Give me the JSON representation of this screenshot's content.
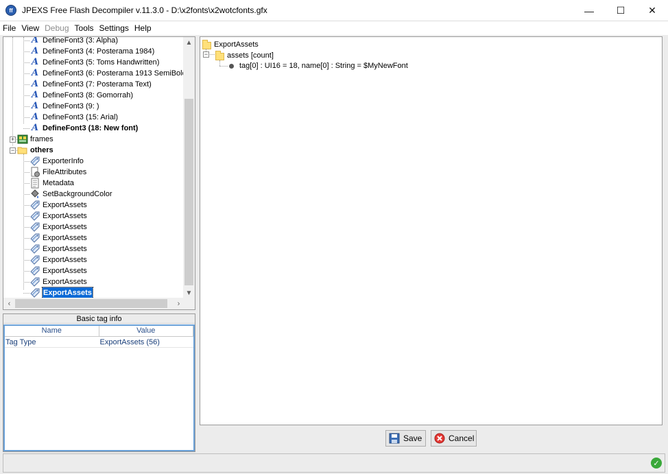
{
  "window": {
    "title": "JPEXS Free Flash Decompiler v.11.3.0 - D:\\x2fonts\\x2wotcfonts.gfx",
    "app_icon": "ff",
    "minimize": "—",
    "maximize": "☐",
    "close": "✕"
  },
  "menu": {
    "items": [
      "File",
      "View",
      "Debug",
      "Tools",
      "Settings",
      "Help"
    ],
    "disabled": [
      "Debug"
    ]
  },
  "tree": {
    "items": [
      {
        "label": "DefineFont3 (3: Alpha)",
        "icon": "font-icon"
      },
      {
        "label": "DefineFont3 (4: Posterama 1984)",
        "icon": "font-icon"
      },
      {
        "label": "DefineFont3 (5: Toms Handwritten)",
        "icon": "font-icon"
      },
      {
        "label": "DefineFont3 (6: Posterama 1913 SemiBold)",
        "icon": "font-icon"
      },
      {
        "label": "DefineFont3 (7: Posterama Text)",
        "icon": "font-icon"
      },
      {
        "label": "DefineFont3 (8: Gomorrah)",
        "icon": "font-icon"
      },
      {
        "label": "DefineFont3 (9: )",
        "icon": "font-icon"
      },
      {
        "label": "DefineFont3 (15: Arial)",
        "icon": "font-icon"
      },
      {
        "label": "DefineFont3 (18: New font)",
        "icon": "font-icon"
      },
      {
        "label": "frames",
        "icon": "frames-icon"
      },
      {
        "label": "others",
        "icon": "folder-open-icon"
      },
      {
        "label": "ExporterInfo",
        "icon": "tag-icon"
      },
      {
        "label": "FileAttributes",
        "icon": "file-attributes-icon"
      },
      {
        "label": "Metadata",
        "icon": "metadata-icon"
      },
      {
        "label": "SetBackgroundColor",
        "icon": "paint-bucket-icon"
      },
      {
        "label": "ExportAssets",
        "icon": "tag-icon"
      },
      {
        "label": "ExportAssets",
        "icon": "tag-icon"
      },
      {
        "label": "ExportAssets",
        "icon": "tag-icon"
      },
      {
        "label": "ExportAssets",
        "icon": "tag-icon"
      },
      {
        "label": "ExportAssets",
        "icon": "tag-icon"
      },
      {
        "label": "ExportAssets",
        "icon": "tag-icon"
      },
      {
        "label": "ExportAssets",
        "icon": "tag-icon"
      },
      {
        "label": "ExportAssets",
        "icon": "tag-icon"
      },
      {
        "label": "ExportAssets",
        "icon": "tag-icon"
      }
    ],
    "selected_index": 23,
    "bold_indices": [
      8,
      10,
      23
    ],
    "expanders": {
      "frames": "+",
      "others": "−"
    }
  },
  "info": {
    "title": "Basic tag info",
    "columns": [
      "Name",
      "Value"
    ],
    "rows": [
      [
        "Tag Type",
        "ExportAssets (56)"
      ]
    ]
  },
  "detail": {
    "root": "ExportAssets",
    "child": "assets [count]",
    "leaf": "tag[0] : UI16 = 18, name[0] : String = $MyNewFont",
    "expander": "−"
  },
  "buttons": {
    "save": "Save",
    "cancel": "Cancel"
  },
  "status": {
    "icon": "ok-check-icon",
    "glyph": "✓"
  },
  "colors": {
    "selection": "#0a6ad6",
    "font_icon": "#2a59b8",
    "table_border": "#6aa1d8"
  }
}
